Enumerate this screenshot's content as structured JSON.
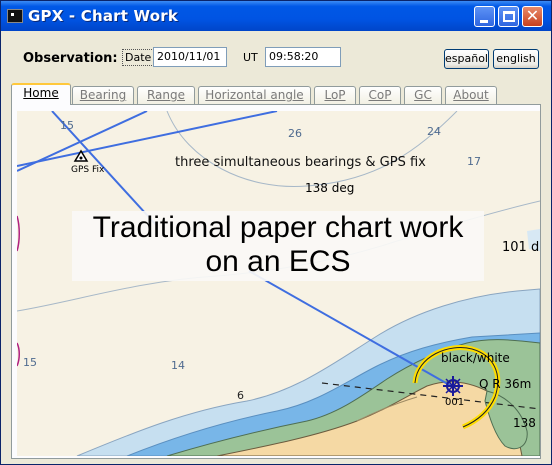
{
  "window": {
    "title": "GPX - Chart Work",
    "controls": {
      "minimize_icon": "minimize-icon",
      "maximize_icon": "maximize-icon",
      "close_icon": "close-icon",
      "close_glyph": "✕"
    },
    "app_icon": "app-icon"
  },
  "observation": {
    "label": "Observation:",
    "date_label": "Date",
    "date_value": "2010/11/01",
    "ut_label": "UT",
    "time_value": "09:58:20"
  },
  "language": {
    "spanish": "español",
    "english": "english"
  },
  "tabs": [
    {
      "label": "Home",
      "active": true
    },
    {
      "label": "Bearing",
      "active": false
    },
    {
      "label": "Range",
      "active": false
    },
    {
      "label": "Horizontal angle",
      "active": false
    },
    {
      "label": "LoP",
      "active": false
    },
    {
      "label": "CoP",
      "active": false
    },
    {
      "label": "GC",
      "active": false
    },
    {
      "label": "About",
      "active": false
    }
  ],
  "chart": {
    "headline_line1": "Traditional paper chart work",
    "headline_line2": "on an ECS",
    "subtitle": "three simultaneous bearings & GPS fix",
    "gps_fix_label": "GPS Fix",
    "bearing_138": "138 deg",
    "bearing_101": "101 d",
    "light_label": "black/white",
    "light_number": "001",
    "quay_label": "Q R 36m",
    "bearing_edge": "138",
    "depths": {
      "d15": "15",
      "d26": "26",
      "d24": "24",
      "d17": "17",
      "d15b": "15",
      "d14": "14",
      "d6": "6"
    },
    "colors": {
      "land": "#f5d9a4",
      "green_strip": "#9bc398",
      "shallow": "#c6dff0",
      "deep_blue": "#78b6e8",
      "bearing_line": "#3f6ee0",
      "light_arc": "#ffdd00"
    }
  }
}
